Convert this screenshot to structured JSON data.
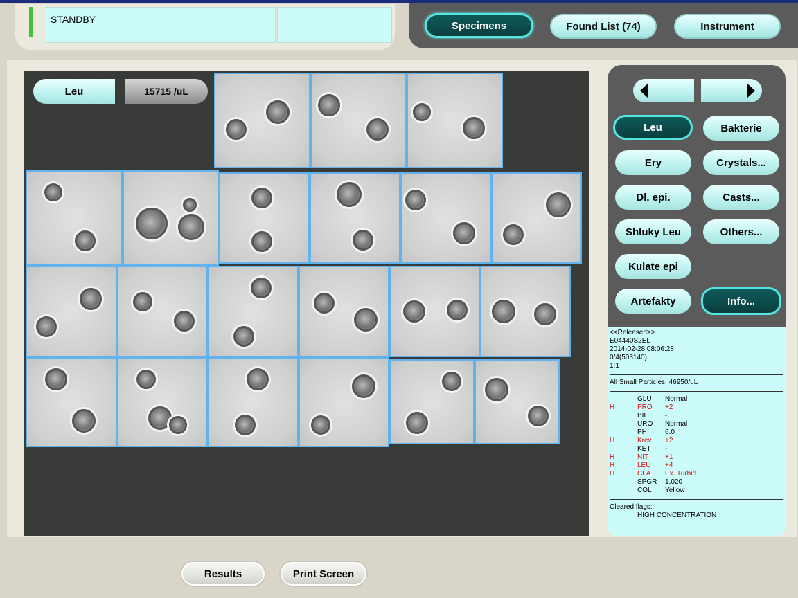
{
  "status": {
    "text": "STANDBY",
    "secondary": ""
  },
  "nav": {
    "specimens": "Specimens",
    "found_list": "Found List (74)",
    "instrument": "Instrument"
  },
  "viewer": {
    "class_label": "Leu",
    "concentration": "15715 /uL"
  },
  "categories": {
    "leu": "Leu",
    "bakterie": "Bakterie",
    "ery": "Ery",
    "crystals": "Crystals...",
    "dl_epi": "Dl. epi.",
    "casts": "Casts...",
    "shluky_leu": "Shluky Leu",
    "others": "Others...",
    "kulate_epi": "Kulate epi",
    "artefakty": "Artefakty",
    "info": "Info..."
  },
  "colors": {
    "active_button": "#0c4a4a",
    "button": "#bff3f0",
    "info_bg": "#ccfcfa",
    "abnormal": "#d01010"
  },
  "info": {
    "released": "<<Released>>",
    "specimen_id": "E04440S2EL",
    "datetime": "2014-02-28 08:06:28",
    "rack": "0/4(503140)",
    "ratio": "1:1",
    "small_particles": "All Small Particles: 46950/uL",
    "results": [
      {
        "flag": "",
        "name": "GLU",
        "value": "Normal",
        "high": false
      },
      {
        "flag": "H",
        "name": "PRO",
        "value": "+2",
        "high": true
      },
      {
        "flag": "",
        "name": "BIL",
        "value": "-",
        "high": false
      },
      {
        "flag": "",
        "name": "URO",
        "value": "Normal",
        "high": false
      },
      {
        "flag": "",
        "name": "PH",
        "value": "6.0",
        "high": false
      },
      {
        "flag": "H",
        "name": "Krev",
        "value": "+2",
        "high": true
      },
      {
        "flag": "",
        "name": "KET",
        "value": "-",
        "high": false
      },
      {
        "flag": "H",
        "name": "NIT",
        "value": "+1",
        "high": true
      },
      {
        "flag": "H",
        "name": "LEU",
        "value": "+4",
        "high": true
      },
      {
        "flag": "H",
        "name": "CLA",
        "value": "Ex. Turbid",
        "high": true
      },
      {
        "flag": "",
        "name": "SPGR",
        "value": "1.020",
        "high": false
      },
      {
        "flag": "",
        "name": "COL",
        "value": "Yellow",
        "high": false
      }
    ],
    "cleared_flags_label": "Cleared flags:",
    "cleared_flags_value": "HIGH CONCENTRATION"
  },
  "bottom": {
    "results": "Results",
    "print_screen": "Print Screen"
  }
}
